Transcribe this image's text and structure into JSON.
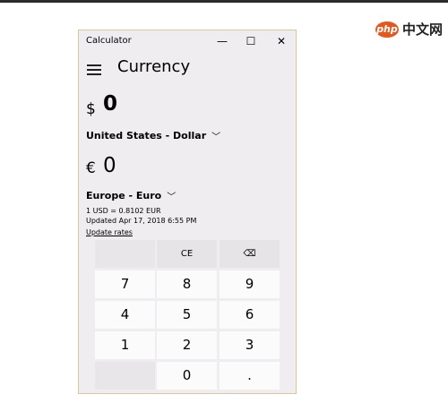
{
  "window": {
    "title": "Calculator",
    "controls": {
      "minimize": "—",
      "maximize": "☐",
      "close": "✕"
    }
  },
  "header": {
    "mode": "Currency"
  },
  "from": {
    "symbol": "$",
    "value": "0",
    "currency": "United States - Dollar"
  },
  "to": {
    "symbol": "€",
    "value": "0",
    "currency": "Europe - Euro"
  },
  "rate_info": {
    "rate": "1 USD = 0.8102 EUR",
    "updated": "Updated Apr 17, 2018 6:55 PM",
    "update_link": "Update rates"
  },
  "keypad": {
    "ce": "CE",
    "backspace": "⌫",
    "digits": [
      "7",
      "8",
      "9",
      "4",
      "5",
      "6",
      "1",
      "2",
      "3",
      "0"
    ],
    "decimal": "."
  },
  "watermark": {
    "logo": "php",
    "text": "中文网"
  }
}
